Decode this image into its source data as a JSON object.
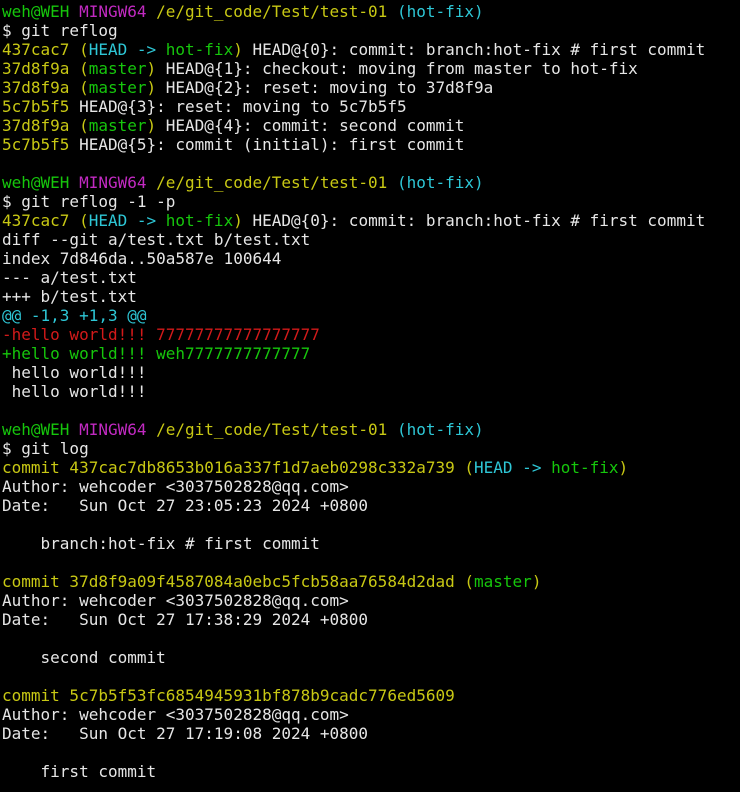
{
  "window": {
    "background": "#000000",
    "colors": {
      "white": "#e6e6e6",
      "yellow": "#c8c814",
      "green": "#16c60c",
      "cyan": "#2ec7d6",
      "magenta": "#c22ac2",
      "red": "#d21a1a"
    }
  },
  "lines": [
    [
      {
        "t": "weh@WEH ",
        "c": "green"
      },
      {
        "t": "MINGW64 ",
        "c": "magenta"
      },
      {
        "t": "/e/git_code/Test/test-01 ",
        "c": "yellow"
      },
      {
        "t": "(hot-fix)",
        "c": "cyan"
      }
    ],
    [
      {
        "t": "$ git reflog",
        "c": "white"
      }
    ],
    [
      {
        "t": "437cac7 ",
        "c": "yellow"
      },
      {
        "t": "(",
        "c": "yellow"
      },
      {
        "t": "HEAD -> ",
        "c": "cyan"
      },
      {
        "t": "hot-fix",
        "c": "green"
      },
      {
        "t": ")",
        "c": "yellow"
      },
      {
        "t": " HEAD@{0}: commit: branch:hot-fix # first commit",
        "c": "white"
      }
    ],
    [
      {
        "t": "37d8f9a ",
        "c": "yellow"
      },
      {
        "t": "(",
        "c": "yellow"
      },
      {
        "t": "master",
        "c": "green"
      },
      {
        "t": ")",
        "c": "yellow"
      },
      {
        "t": " HEAD@{1}: checkout: moving from master to hot-fix",
        "c": "white"
      }
    ],
    [
      {
        "t": "37d8f9a ",
        "c": "yellow"
      },
      {
        "t": "(",
        "c": "yellow"
      },
      {
        "t": "master",
        "c": "green"
      },
      {
        "t": ")",
        "c": "yellow"
      },
      {
        "t": " HEAD@{2}: reset: moving to 37d8f9a",
        "c": "white"
      }
    ],
    [
      {
        "t": "5c7b5f5",
        "c": "yellow"
      },
      {
        "t": " HEAD@{3}: reset: moving to 5c7b5f5",
        "c": "white"
      }
    ],
    [
      {
        "t": "37d8f9a ",
        "c": "yellow"
      },
      {
        "t": "(",
        "c": "yellow"
      },
      {
        "t": "master",
        "c": "green"
      },
      {
        "t": ")",
        "c": "yellow"
      },
      {
        "t": " HEAD@{4}: commit: second commit",
        "c": "white"
      }
    ],
    [
      {
        "t": "5c7b5f5",
        "c": "yellow"
      },
      {
        "t": " HEAD@{5}: commit (initial): first commit",
        "c": "white"
      }
    ],
    [
      {
        "t": "",
        "c": "white"
      }
    ],
    [
      {
        "t": "weh@WEH ",
        "c": "green"
      },
      {
        "t": "MINGW64 ",
        "c": "magenta"
      },
      {
        "t": "/e/git_code/Test/test-01 ",
        "c": "yellow"
      },
      {
        "t": "(hot-fix)",
        "c": "cyan"
      }
    ],
    [
      {
        "t": "$ git reflog -1 -p",
        "c": "white"
      }
    ],
    [
      {
        "t": "437cac7 ",
        "c": "yellow"
      },
      {
        "t": "(",
        "c": "yellow"
      },
      {
        "t": "HEAD -> ",
        "c": "cyan"
      },
      {
        "t": "hot-fix",
        "c": "green"
      },
      {
        "t": ")",
        "c": "yellow"
      },
      {
        "t": " HEAD@{0}: commit: branch:hot-fix # first commit",
        "c": "white"
      }
    ],
    [
      {
        "t": "diff --git a/test.txt b/test.txt",
        "c": "white"
      }
    ],
    [
      {
        "t": "index 7d846da..50a587e 100644",
        "c": "white"
      }
    ],
    [
      {
        "t": "--- a/test.txt",
        "c": "white"
      }
    ],
    [
      {
        "t": "+++ b/test.txt",
        "c": "white"
      }
    ],
    [
      {
        "t": "@@ -1,3 +1,3 @@",
        "c": "cyan"
      }
    ],
    [
      {
        "t": "-hello world!!! 77777777777777777",
        "c": "red"
      }
    ],
    [
      {
        "t": "+hello world!!! weh7777777777777",
        "c": "green"
      }
    ],
    [
      {
        "t": " hello world!!!",
        "c": "white"
      }
    ],
    [
      {
        "t": " hello world!!!",
        "c": "white"
      }
    ],
    [
      {
        "t": "",
        "c": "white"
      }
    ],
    [
      {
        "t": "weh@WEH ",
        "c": "green"
      },
      {
        "t": "MINGW64 ",
        "c": "magenta"
      },
      {
        "t": "/e/git_code/Test/test-01 ",
        "c": "yellow"
      },
      {
        "t": "(hot-fix)",
        "c": "cyan"
      }
    ],
    [
      {
        "t": "$ git log",
        "c": "white"
      }
    ],
    [
      {
        "t": "commit 437cac7db8653b016a337f1d7aeb0298c332a739 ",
        "c": "yellow"
      },
      {
        "t": "(",
        "c": "yellow"
      },
      {
        "t": "HEAD -> ",
        "c": "cyan"
      },
      {
        "t": "hot-fix",
        "c": "green"
      },
      {
        "t": ")",
        "c": "yellow"
      }
    ],
    [
      {
        "t": "Author: wehcoder <3037502828@qq.com>",
        "c": "white"
      }
    ],
    [
      {
        "t": "Date:   Sun Oct 27 23:05:23 2024 +0800",
        "c": "white"
      }
    ],
    [
      {
        "t": "",
        "c": "white"
      }
    ],
    [
      {
        "t": "    branch:hot-fix # first commit",
        "c": "white"
      }
    ],
    [
      {
        "t": "",
        "c": "white"
      }
    ],
    [
      {
        "t": "commit 37d8f9a09f4587084a0ebc5fcb58aa76584d2dad ",
        "c": "yellow"
      },
      {
        "t": "(",
        "c": "yellow"
      },
      {
        "t": "master",
        "c": "green"
      },
      {
        "t": ")",
        "c": "yellow"
      }
    ],
    [
      {
        "t": "Author: wehcoder <3037502828@qq.com>",
        "c": "white"
      }
    ],
    [
      {
        "t": "Date:   Sun Oct 27 17:38:29 2024 +0800",
        "c": "white"
      }
    ],
    [
      {
        "t": "",
        "c": "white"
      }
    ],
    [
      {
        "t": "    second commit",
        "c": "white"
      }
    ],
    [
      {
        "t": "",
        "c": "white"
      }
    ],
    [
      {
        "t": "commit 5c7b5f53fc6854945931bf878b9cadc776ed5609",
        "c": "yellow"
      }
    ],
    [
      {
        "t": "Author: wehcoder <3037502828@qq.com>",
        "c": "white"
      }
    ],
    [
      {
        "t": "Date:   Sun Oct 27 17:19:08 2024 +0800",
        "c": "white"
      }
    ],
    [
      {
        "t": "",
        "c": "white"
      }
    ],
    [
      {
        "t": "    first commit",
        "c": "white"
      }
    ]
  ]
}
